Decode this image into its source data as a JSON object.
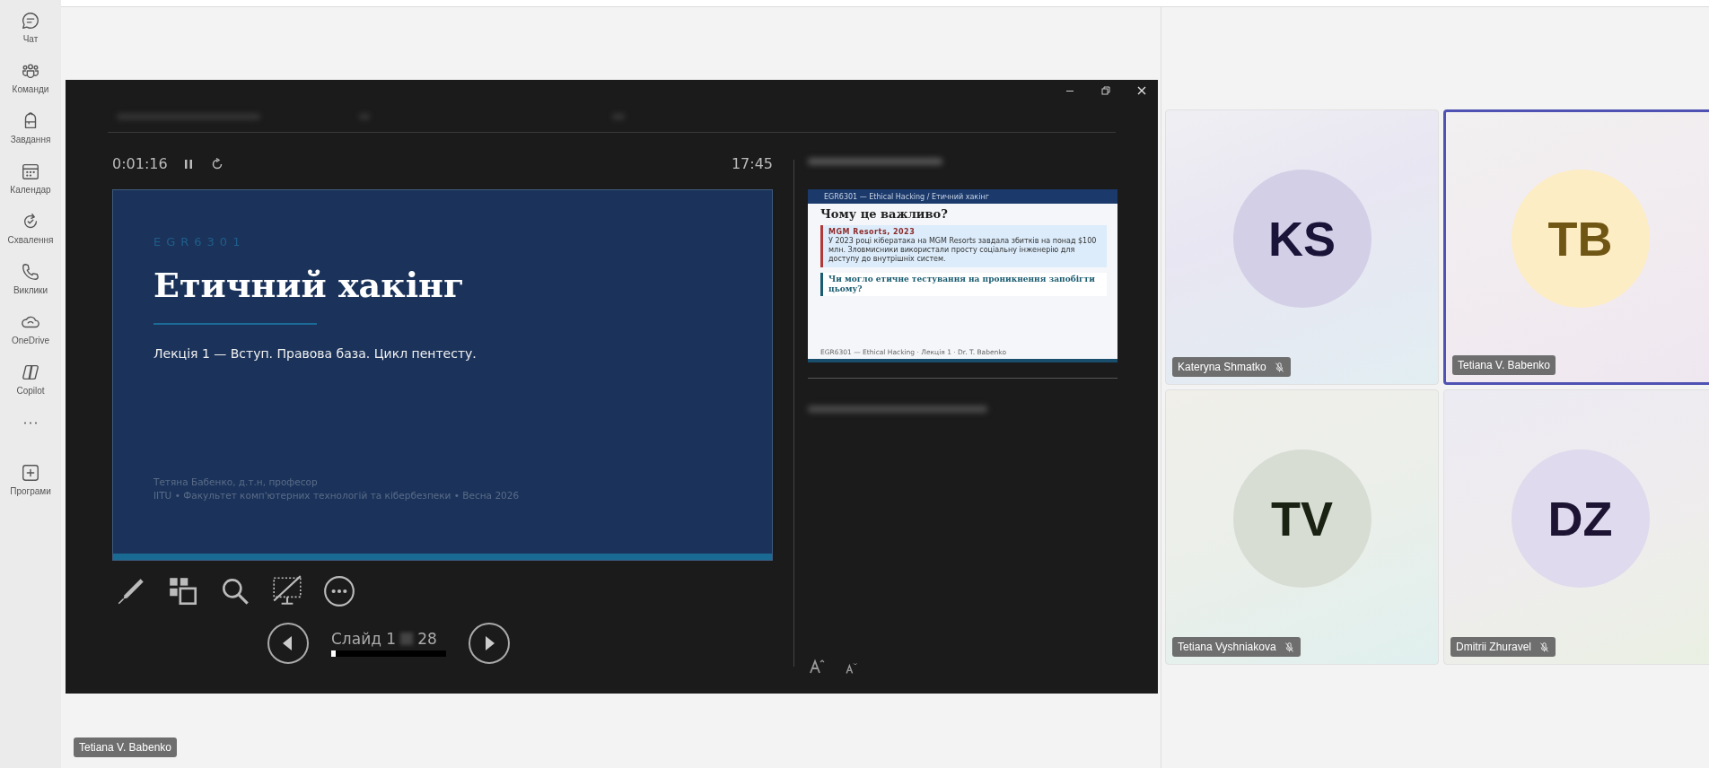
{
  "sidebar": {
    "items": [
      {
        "label": "Чат"
      },
      {
        "label": "Команди"
      },
      {
        "label": "Завдання"
      },
      {
        "label": "Календар"
      },
      {
        "label": "Схвалення"
      },
      {
        "label": "Виклики"
      },
      {
        "label": "OneDrive"
      },
      {
        "label": "Copilot"
      },
      {
        "kind": "more"
      },
      {
        "label": "Програми"
      }
    ]
  },
  "presenter": {
    "timer": "0:01:16",
    "clock": "17:45",
    "slide": {
      "code": "EGR6301",
      "title": "Етичний хакінг",
      "subtitle": "Лекція 1 — Вступ. Правова база. Цикл пентесту.",
      "author": "Тетяна Бабенко, д.т.н, професор",
      "institution": "IITU • Факультет комп'ютерних технологій та кібербезпеки • Весна 2026"
    },
    "next_slide": {
      "header": "EGR6301 — Ethical Hacking / Етичний хакінг",
      "title": "Чому це важливо?",
      "callout_label": "MGM Resorts, 2023",
      "callout_text": "У 2023 році кібератака на MGM Resorts завдала збитків на понад $100 млн. Зловмисники використали просту соціальну інженерію для доступу до внутрішніх систем.",
      "question": "Чи могло етичне тестування на проникнення запобігти цьому?",
      "footer": "EGR6301 — Ethical Hacking · Лекція 1 · Dr. T. Babenko"
    },
    "slide_counter_start": "Слайд 1",
    "slide_counter_end": "28",
    "progress": {
      "level": 0.036
    }
  },
  "participants": [
    {
      "name": "Kateryna Shmatko",
      "initials": "KS",
      "color": "#d3cfe6",
      "muted": true,
      "selected": false
    },
    {
      "name": "Tetiana V. Babenko",
      "initials": "TB",
      "color": "#fdedc4",
      "muted": false,
      "selected": true
    },
    {
      "name": "Tetiana Vyshniakova",
      "initials": "TV",
      "color": "#d8ddd4",
      "muted": true,
      "selected": false
    },
    {
      "name": "Dmitrii Zhuravel",
      "initials": "DZ",
      "color": "#dfdaed",
      "muted": true,
      "selected": false
    }
  ],
  "presenter_tag": "Tetiana V. Babenko"
}
